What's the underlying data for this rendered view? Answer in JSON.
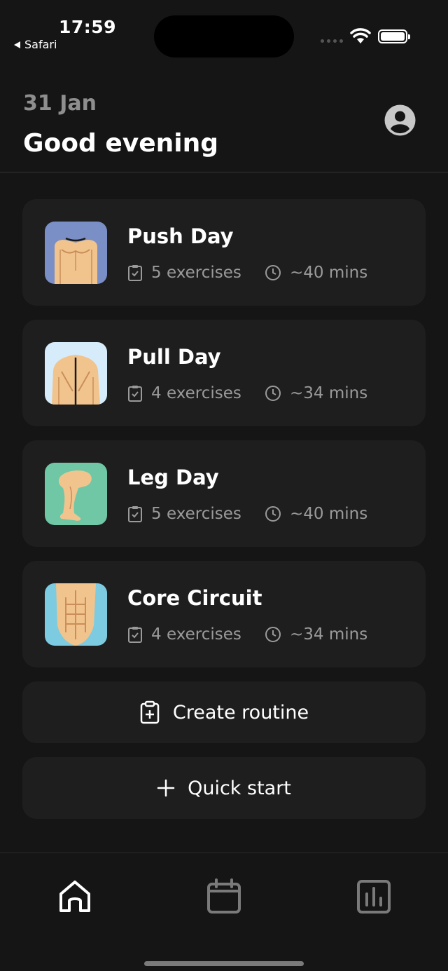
{
  "status": {
    "time": "17:59",
    "back_app": "Safari"
  },
  "header": {
    "date": "31 Jan",
    "greeting": "Good evening"
  },
  "routines": [
    {
      "title": "Push Day",
      "exercises": "5 exercises",
      "duration": "~40 mins",
      "thumb_bg": "#7b8fc7"
    },
    {
      "title": "Pull Day",
      "exercises": "4 exercises",
      "duration": "~34 mins",
      "thumb_bg": "#d6ecfb"
    },
    {
      "title": "Leg Day",
      "exercises": "5 exercises",
      "duration": "~40 mins",
      "thumb_bg": "#6fc7a6"
    },
    {
      "title": "Core Circuit",
      "exercises": "4 exercises",
      "duration": "~34 mins",
      "thumb_bg": "#7ccbe0"
    }
  ],
  "actions": {
    "create_routine": "Create routine",
    "quick_start": "Quick start"
  },
  "tabs": [
    {
      "icon": "home-icon",
      "active": true
    },
    {
      "icon": "calendar-icon",
      "active": false
    },
    {
      "icon": "stats-icon",
      "active": false
    }
  ],
  "colors": {
    "background": "#151515",
    "card": "#1e1e1e",
    "muted_text": "#9a9a9a",
    "skin": "#f2c48d"
  }
}
